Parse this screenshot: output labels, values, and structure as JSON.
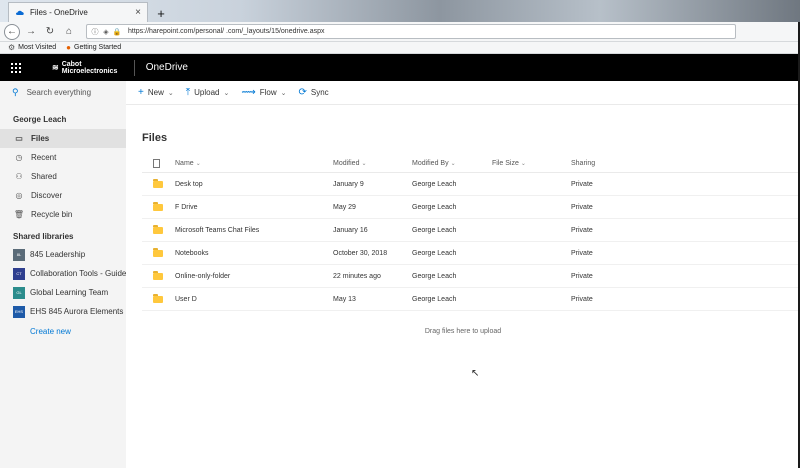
{
  "browser": {
    "tab_title": "Files - OneDrive",
    "tab_close": "×",
    "new_tab": "+",
    "url": "https://harepoint.com/personal/ .com/_layouts/15/onedrive.aspx",
    "bookmarks": [
      {
        "label": "Most Visited",
        "icon": "gear-icon"
      },
      {
        "label": "Getting Started",
        "icon": "firefox-icon"
      }
    ]
  },
  "suite": {
    "brand_line1": "Cabot",
    "brand_line2": "Microelectronics",
    "app_name": "OneDrive"
  },
  "commands": {
    "search_placeholder": "Search everything",
    "new": "New",
    "upload": "Upload",
    "flow": "Flow",
    "sync": "Sync"
  },
  "nav": {
    "user": "George Leach",
    "items": [
      {
        "label": "Files",
        "icon": "folder-icon"
      },
      {
        "label": "Recent",
        "icon": "clock-icon"
      },
      {
        "label": "Shared",
        "icon": "people-icon"
      },
      {
        "label": "Discover",
        "icon": "compass-icon"
      },
      {
        "label": "Recycle bin",
        "icon": "trash-icon"
      }
    ],
    "shared_title": "Shared libraries",
    "libraries": [
      {
        "label": "845 Leadership",
        "badge": "8L",
        "color": "#5a6b78"
      },
      {
        "label": "Collaboration Tools - Guide",
        "badge": "CT",
        "color": "#2f3f8f"
      },
      {
        "label": "Global Learning Team",
        "badge": "GL",
        "color": "#2b8c8c"
      },
      {
        "label": "EHS 845 Aurora Elements",
        "badge": "EHS",
        "color": "#1e5aa8"
      }
    ],
    "create_new": "Create new"
  },
  "main": {
    "title": "Files",
    "columns": {
      "name": "Name",
      "modified": "Modified",
      "modified_by": "Modified By",
      "file_size": "File Size",
      "sharing": "Sharing"
    },
    "rows": [
      {
        "name": "Desk top",
        "modified": "January 9",
        "modified_by": "George Leach",
        "size": "",
        "sharing": "Private"
      },
      {
        "name": "F Drive",
        "modified": "May 29",
        "modified_by": "George Leach",
        "size": "",
        "sharing": "Private"
      },
      {
        "name": "Microsoft Teams Chat Files",
        "modified": "January 16",
        "modified_by": "George Leach",
        "size": "",
        "sharing": "Private"
      },
      {
        "name": "Notebooks",
        "modified": "October 30, 2018",
        "modified_by": "George Leach",
        "size": "",
        "sharing": "Private"
      },
      {
        "name": "Online-only-folder",
        "modified": "22 minutes ago",
        "modified_by": "George Leach",
        "size": "",
        "sharing": "Private"
      },
      {
        "name": "User D",
        "modified": "May 13",
        "modified_by": "George Leach",
        "size": "",
        "sharing": "Private"
      }
    ],
    "drop_hint": "Drag files here to upload"
  }
}
